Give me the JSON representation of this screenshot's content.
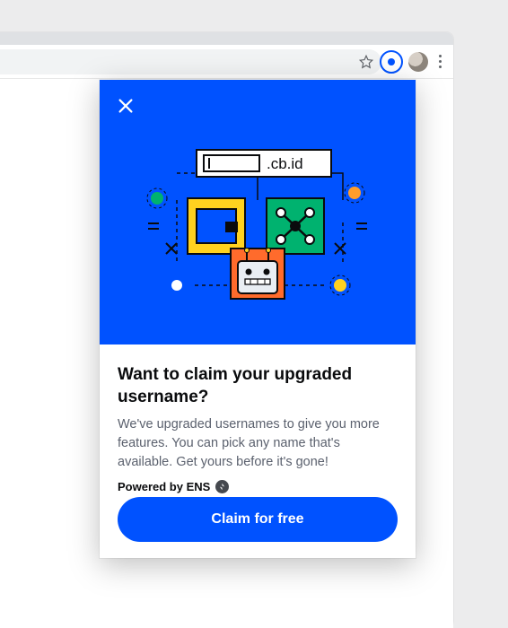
{
  "browser": {
    "star_icon": "star-icon",
    "extension_icon": "coinbase-wallet-extension-icon",
    "avatar": "profile-avatar",
    "menu_icon": "kebab-menu-icon"
  },
  "popup": {
    "close_icon": "close-icon",
    "hero": {
      "domain_suffix": ".cb.id"
    },
    "title": "Want to claim your upgraded username?",
    "description": "We've upgraded usernames to give you more features. You can pick any name that's available. Get yours before it's gone!",
    "powered_label": "Powered by ENS",
    "cta_label": "Claim for free"
  },
  "colors": {
    "accent": "#0052ff"
  }
}
